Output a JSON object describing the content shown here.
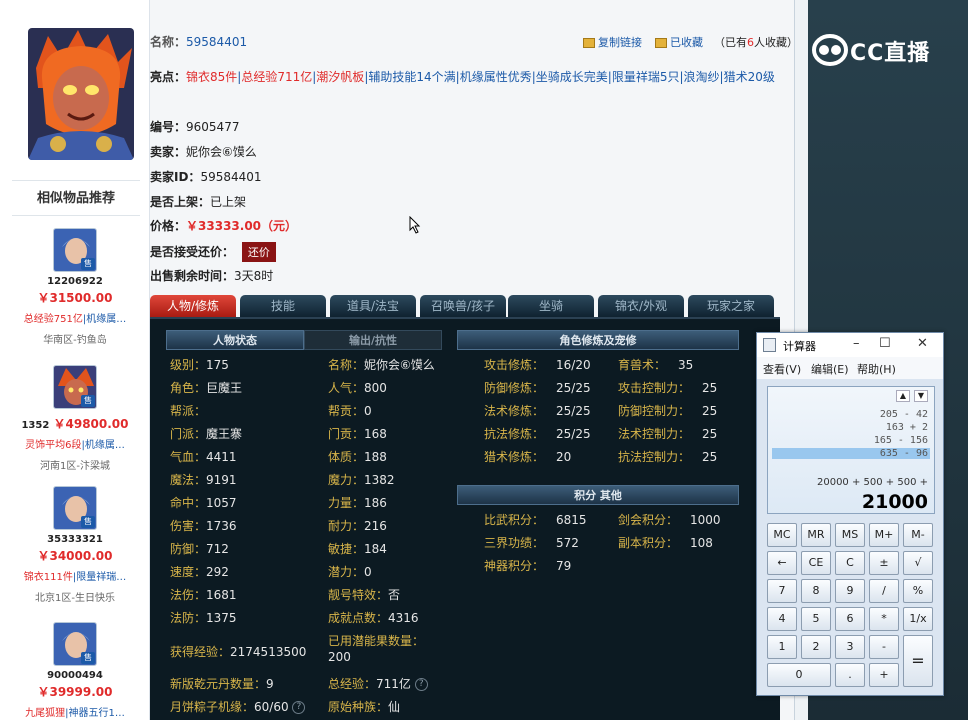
{
  "item": {
    "name_label": "名称：",
    "name_value": "59584401",
    "copy_link": "复制链接",
    "favorited": "已收藏",
    "fav_count_prefix": "（已有",
    "fav_count": "6",
    "fav_count_suffix": "人收藏）",
    "highlights_label": "亮点：",
    "highlights": [
      {
        "text": "锦衣85件",
        "color": "#e02b2b"
      },
      {
        "text": "总经验711亿",
        "color": "#e02b2b"
      },
      {
        "text": "潮汐帆板",
        "color": "#e02b2b"
      },
      {
        "text": "辅助技能14个满",
        "color": "#1c5aa8"
      },
      {
        "text": "机缘属性优秀",
        "color": "#1c5aa8"
      },
      {
        "text": "坐骑成长完美",
        "color": "#1c5aa8"
      },
      {
        "text": "限量祥瑞5只",
        "color": "#1c5aa8"
      },
      {
        "text": "浪淘纱",
        "color": "#1c5aa8"
      },
      {
        "text": "猎术20级",
        "color": "#1c5aa8"
      }
    ],
    "number_label": "编号：",
    "number_value": "9605477",
    "seller_label": "卖家：",
    "seller_value": "妮你会⑥馍么",
    "seller_id_label": "卖家ID：",
    "seller_id_value": "59584401",
    "listed_label": "是否上架：",
    "listed_value": "已上架",
    "price_label": "价格：",
    "price_value": "￥33333.00（元）",
    "bargain_label": "是否接受还价：",
    "bargain_button": "还价",
    "remain_label": "出售剩余时间：",
    "remain_value": "3天8时"
  },
  "recommend": {
    "title": "相似物品推荐",
    "items": [
      {
        "id": "12206922",
        "price": "￥31500.00",
        "hl_red": "总经验751亿",
        "hl_blue": "|机缘属…",
        "server": "华南区-钓鱼岛",
        "tag": "售"
      },
      {
        "id": "1352",
        "price": "￥49800.00",
        "hl_red": "灵饰平均6段",
        "hl_blue": "|机缘属…",
        "server": "河南1区-汴梁城",
        "tag": "售"
      },
      {
        "id": "35333321",
        "price": "￥34000.00",
        "hl_red": "锦衣111件",
        "hl_blue": "|限量祥瑞…",
        "server": "北京1区-生日快乐",
        "tag": "售"
      },
      {
        "id": "90000494",
        "price": "￥39999.00",
        "hl_red": "九尾狐狸",
        "hl_blue": "|神器五行1…",
        "server": "",
        "tag": "售"
      }
    ]
  },
  "tabs": [
    "人物/修炼",
    "技能",
    "道具/法宝",
    "召唤兽/孩子",
    "坐骑",
    "锦衣/外观",
    "玩家之家"
  ],
  "panel": {
    "hdr_status": "人物状态",
    "hdr_resist": "输出/抗性",
    "hdr_cultivation": "角色修炼及宠修",
    "hdr_points": "积分 其他",
    "left_col": [
      {
        "k": "级别：",
        "v": "175"
      },
      {
        "k": "角色：",
        "v": "巨魔王"
      },
      {
        "k": "帮派：",
        "v": ""
      },
      {
        "k": "门派：",
        "v": "魔王寨"
      },
      {
        "k": "气血：",
        "v": "4411"
      },
      {
        "k": "魔法：",
        "v": "9191"
      },
      {
        "k": "命中：",
        "v": "1057"
      },
      {
        "k": "伤害：",
        "v": "1736"
      },
      {
        "k": "防御：",
        "v": "712"
      },
      {
        "k": "速度：",
        "v": "292"
      },
      {
        "k": "法伤：",
        "v": "1681"
      },
      {
        "k": "法防：",
        "v": "1375"
      }
    ],
    "mid_col": [
      {
        "k": "名称：",
        "v": "妮你会⑥馍么"
      },
      {
        "k": "人气：",
        "v": "800"
      },
      {
        "k": "帮贡：",
        "v": "0"
      },
      {
        "k": "门贡：",
        "v": "168"
      },
      {
        "k": "体质：",
        "v": "188"
      },
      {
        "k": "魔力：",
        "v": "1382"
      },
      {
        "k": "力量：",
        "v": "186"
      },
      {
        "k": "耐力：",
        "v": "216"
      },
      {
        "k": "敏捷：",
        "v": "184"
      },
      {
        "k": "潜力：",
        "v": "0"
      },
      {
        "k": "靓号特效：",
        "v": "否"
      },
      {
        "k": "成就点数：",
        "v": "4316"
      }
    ],
    "exp": {
      "k": "获得经验：",
      "v": "2174513500"
    },
    "used_potential": {
      "k": "已用潜能果数量：",
      "v": "200"
    },
    "qianyuan": {
      "k": "新版乾元丹数量：",
      "v": "9"
    },
    "total_exp": {
      "k": "总经验：",
      "v": "711亿"
    },
    "yuebing": {
      "k": "月饼粽子机缘：",
      "v": "60/60"
    },
    "origin": {
      "k": "原始种族：",
      "v": "仙"
    },
    "cultivation": [
      {
        "k": "攻击修炼：",
        "v": "16/20",
        "k2": "育兽术：",
        "v2": "35"
      },
      {
        "k": "防御修炼：",
        "v": "25/25",
        "k2": "攻击控制力：",
        "v2": "25"
      },
      {
        "k": "法术修炼：",
        "v": "25/25",
        "k2": "防御控制力：",
        "v2": "25"
      },
      {
        "k": "抗法修炼：",
        "v": "25/25",
        "k2": "法术控制力：",
        "v2": "25"
      },
      {
        "k": "猎术修炼：",
        "v": "20",
        "k2": "抗法控制力：",
        "v2": "25"
      }
    ],
    "points": [
      {
        "k": "比武积分：",
        "v": "6815",
        "k2": "剑会积分：",
        "v2": "1000"
      },
      {
        "k": "三界功绩：",
        "v": "572",
        "k2": "副本积分：",
        "v2": "108"
      },
      {
        "k": "神器积分：",
        "v": "79",
        "k2": "",
        "v2": ""
      }
    ]
  },
  "calculator": {
    "title": "计算器",
    "menu": [
      "查看(V)",
      "编辑(E)",
      "帮助(H)"
    ],
    "history": [
      "205 - 42",
      "163 + 2",
      "165 - 156",
      "635 - 96"
    ],
    "expression": "20000 + 500 + 500 +",
    "result": "21000",
    "buttons": [
      [
        "MC",
        "MR",
        "MS",
        "M+",
        "M-"
      ],
      [
        "←",
        "CE",
        "C",
        "±",
        "√"
      ],
      [
        "7",
        "8",
        "9",
        "/",
        "%"
      ],
      [
        "4",
        "5",
        "6",
        "*",
        "1/x"
      ],
      [
        "1",
        "2",
        "3",
        "-",
        "="
      ],
      [
        "0",
        ".",
        "+"
      ]
    ]
  },
  "watermark": "CC直播",
  "colors": {
    "accent_red": "#e02b2b",
    "link_blue": "#1c5aa8",
    "label_gold": "#d8b54a"
  }
}
